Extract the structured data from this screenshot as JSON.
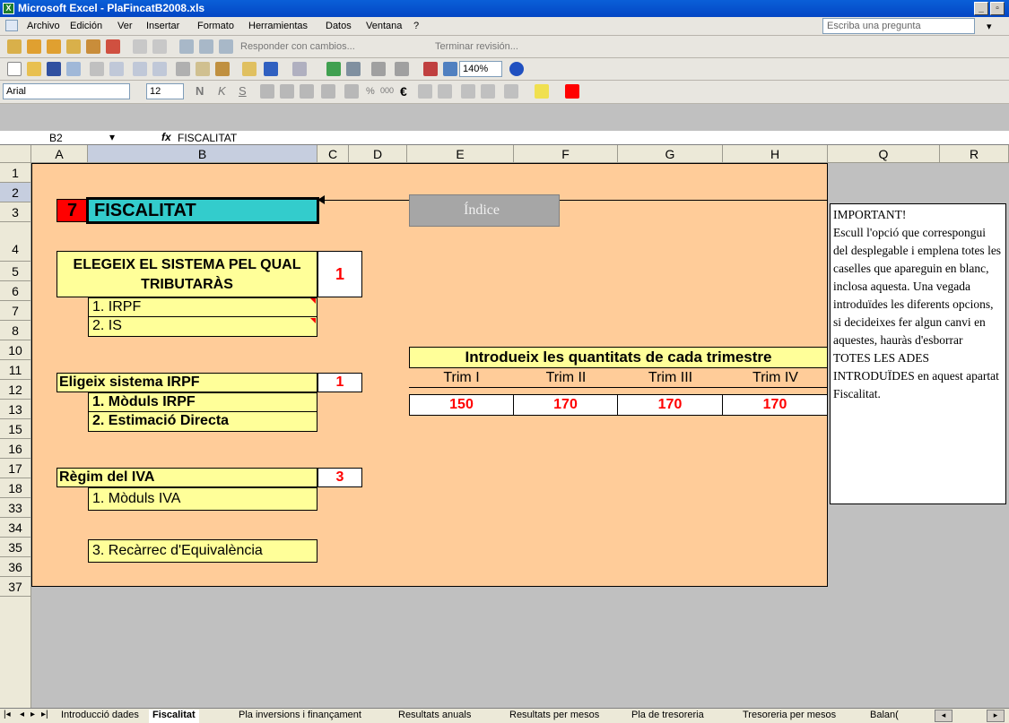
{
  "window": {
    "title": "Microsoft Excel - PlaFincatB2008.xls"
  },
  "menu": [
    "Archivo",
    "Edición",
    "Ver",
    "Insertar",
    "Formato",
    "Herramientas",
    "Datos",
    "Ventana",
    "?"
  ],
  "ask_placeholder": "Escriba una pregunta",
  "review_toolbar": {
    "respond": "Responder con cambios...",
    "end_review": "Terminar revisión..."
  },
  "standard_toolbar": {
    "zoom": "140%"
  },
  "format_toolbar": {
    "font": "Arial",
    "size": "12",
    "bold": "N",
    "italic": "K",
    "underline": "S",
    "percent": "%",
    "thousands": "000",
    "euro": "€"
  },
  "formula_bar": {
    "name_box": "B2",
    "fx": "fx",
    "content": "FISCALITAT"
  },
  "columns": [
    "A",
    "B",
    "C",
    "D",
    "E",
    "F",
    "G",
    "H",
    "Q",
    "R"
  ],
  "rows": [
    "1",
    "2",
    "3",
    "4",
    "5",
    "6",
    "7",
    "8",
    "10",
    "11",
    "12",
    "13",
    "15",
    "16",
    "17",
    "18",
    "33",
    "34",
    "35",
    "36",
    "37"
  ],
  "sheet": {
    "section_number": "7",
    "section_title": "FISCALITAT",
    "index_button": "Índice",
    "choose_system_label": "ELEGEIX EL SISTEMA PEL QUAL TRIBUTARÀS",
    "choose_system_value": "1",
    "option_irpf": "1. IRPF",
    "option_is": "2. IS",
    "irpf_label": "Eligeix sistema IRPF",
    "irpf_value": "1",
    "irpf_opt1": "1. Mòduls IRPF",
    "irpf_opt2": "2. Estimació Directa",
    "iva_label": "Règim del IVA",
    "iva_value": "3",
    "iva_opt1": "1. Mòduls IVA",
    "iva_opt3": "3. Recàrrec d'Equivalència",
    "quarters_title": "Introdueix les quantitats de cada trimestre",
    "quarters": [
      {
        "label": "Trim I",
        "value": "150"
      },
      {
        "label": "Trim II",
        "value": "170"
      },
      {
        "label": "Trim III",
        "value": "170"
      },
      {
        "label": "Trim IV",
        "value": "170"
      }
    ]
  },
  "note": {
    "heading": "IMPORTANT!",
    "body": "Escull l'opció que correspongui del desplegable i emplena totes les caselles que apareguin en blanc, inclosa aquesta. Una vegada introduïdes les diferents opcions, si decideixes fer algun canvi en aquestes, hauràs d'esborrar TOTES LES ADES INTRODUÏDES en aquest apartat Fiscalitat."
  },
  "tabs": [
    "Introducció dades",
    "Fiscalitat",
    "Pla inversions i finançament",
    "Resultats anuals",
    "Resultats per mesos",
    "Pla de tresoreria",
    "Tresoreria per mesos",
    "Balan("
  ],
  "colors": {
    "peach": "#ffcc99",
    "yellow": "#ffff99",
    "teal": "#33cccc",
    "red": "#ff0000",
    "index_button": "#a6a6a6"
  }
}
